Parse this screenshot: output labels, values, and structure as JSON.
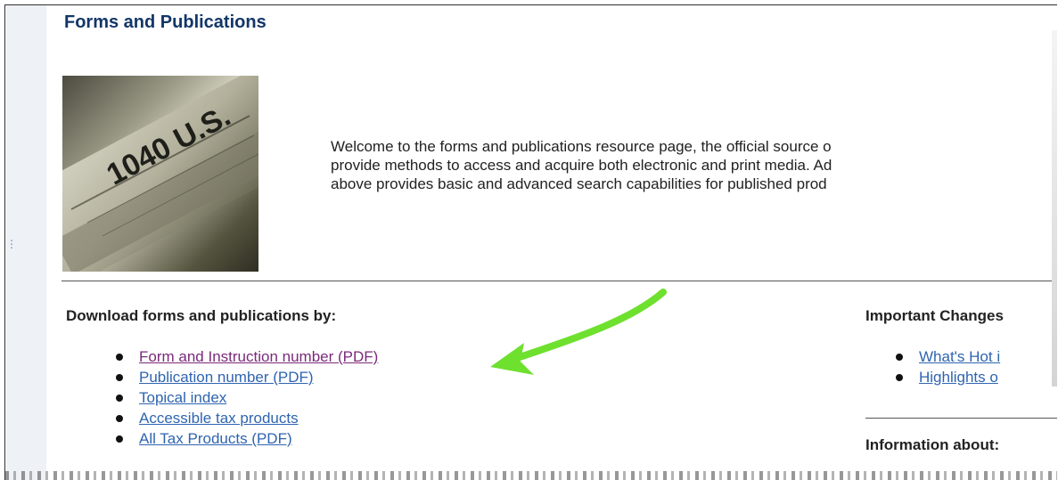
{
  "page": {
    "title": "Forms and Publications",
    "welcome_lines": [
      "Welcome to the forms and publications resource page, the official source o",
      "provide methods to access and acquire both electronic and print media. Ad",
      "above provides basic and advanced search capabilities for published prod"
    ]
  },
  "image": {
    "label": "1040 U.S.",
    "icon": "tax-form-image"
  },
  "downloads": {
    "label": "Download forms and publications by:",
    "items": [
      "Form and Instruction number (PDF)",
      "Publication number (PDF)",
      "Topical index",
      "Accessible tax products",
      "All Tax Products (PDF)"
    ]
  },
  "important": {
    "label": "Important Changes",
    "items": [
      "What's Hot i",
      "Highlights o"
    ]
  },
  "information": {
    "label": "Information about:"
  },
  "colors": {
    "title": "#123668",
    "link": "#2f64b0",
    "visited_link": "#7b2a7b",
    "arrow": "#6ee02e"
  }
}
